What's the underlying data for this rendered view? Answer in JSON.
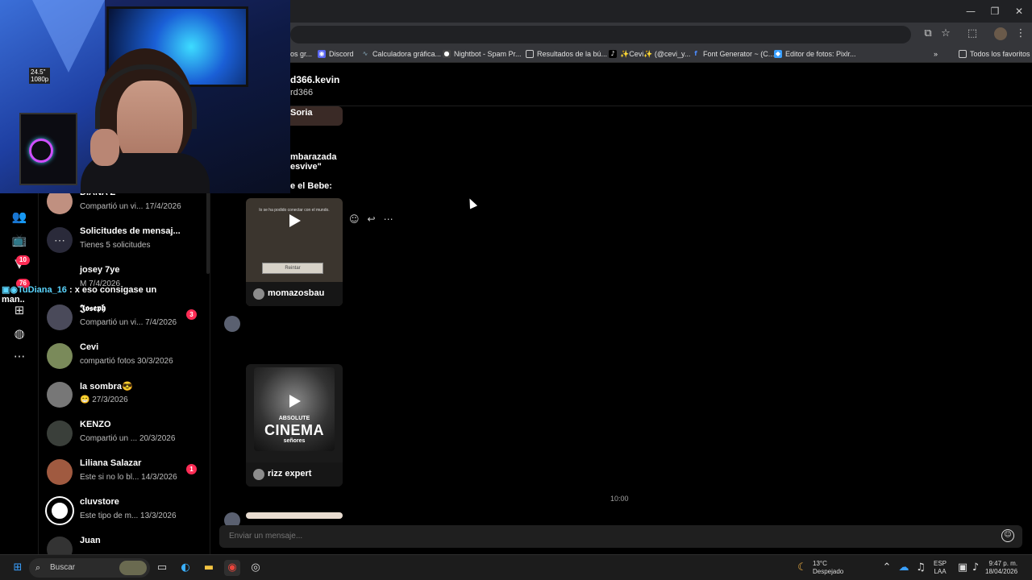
{
  "browser": {
    "bookmarks": [
      "os gr...",
      "Discord",
      "Calculadora gráfica...",
      "Nightbot - Spam Pr...",
      "Resultados de la bú...",
      "✨Cevi✨ (@cevi_y...",
      "Font Generator ~ (C...",
      "Editor de fotos: Pixlr..."
    ],
    "all_bookmarks_label": "Todos los favoritos"
  },
  "rail": {
    "badge_notifications": "10",
    "badge_inbox": "76"
  },
  "conversations": [
    {
      "name": "DIANA Z",
      "preview": "Compartió un vi...",
      "date": "17/4/2026",
      "unread": ""
    },
    {
      "name": "Solicitudes de mensaj...",
      "preview": "Tienes 5 solicitudes",
      "date": "",
      "unread": ""
    },
    {
      "name": "josey 7ye",
      "preview": "M 7/4/2026",
      "date": "",
      "unread": ""
    },
    {
      "name": "𝕵𝖔𝖘𝖊𝖕𝖍",
      "preview": "Compartió un vi...",
      "date": "7/4/2026",
      "unread": "3"
    },
    {
      "name": "Cevi",
      "preview": "compartió fotos",
      "date": "30/3/2026",
      "unread": ""
    },
    {
      "name": "la sombra😎",
      "preview": "😁",
      "date": "27/3/2026",
      "unread": ""
    },
    {
      "name": "KENZO",
      "preview": "Compartió un ...",
      "date": "20/3/2026",
      "unread": ""
    },
    {
      "name": "Liliana Salazar",
      "preview": "Este si no lo bl...",
      "date": "14/3/2026",
      "unread": "1"
    },
    {
      "name": "cluvstore",
      "preview": "Este tipo de m...",
      "date": "13/3/2026",
      "unread": ""
    },
    {
      "name": "Juan",
      "preview": "",
      "date": "",
      "unread": ""
    }
  ],
  "chat": {
    "title": "d366.kevin",
    "subtitle": "rd366",
    "messages": {
      "fragment1": "Soria",
      "fragment2": "mbarazada",
      "fragment3": "esvive\"",
      "fragment4": "e el Bebe:"
    },
    "video1": {
      "overlay_text": "lo se ha podido conectar con el mundo.",
      "button_text": "Reintar",
      "author": "momazosbau"
    },
    "video2": {
      "line1": "ABSOLUTE",
      "line2": "CINEMA",
      "line3": "señores",
      "author": "rizz expert"
    },
    "time_separator": "10:00",
    "composer_placeholder": "Enviar un mensaje..."
  },
  "stream_overlay": {
    "user": "TuDiana_16",
    "message": ": x eso consigase un",
    "continuation": "man..",
    "monitor_label1": "24.5\"",
    "monitor_label2": "1080p"
  },
  "taskbar": {
    "search_label": "Buscar",
    "weather_temp": "13°C",
    "weather_desc": "Despejado",
    "lang1": "ESP",
    "lang2": "LAA",
    "time": "9:47 p. m.",
    "date": "18/04/2026"
  }
}
